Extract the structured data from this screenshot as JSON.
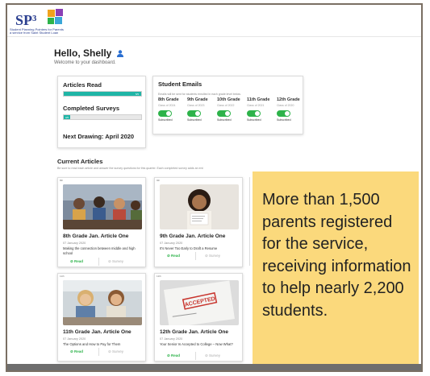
{
  "logo": {
    "text": "SP³",
    "tagline": "Student Planning Pointers for Parents\na service from Saint Student Loan"
  },
  "header": {
    "greeting": "Hello, Shelly",
    "welcome": "Welcome to your dashboard."
  },
  "stats": {
    "articles_read_label": "Articles Read",
    "articles_read_progress": 1.0,
    "articles_read_text": "5/5",
    "completed_surveys_label": "Completed Surveys",
    "completed_surveys_progress": 0.08,
    "completed_surveys_text": "0/5",
    "next_drawing": "Next Drawing: April 2020"
  },
  "emails": {
    "title": "Student Emails",
    "subtitle": "Emails will be sent for students enrolled in each grade level below.",
    "grades": [
      {
        "grade": "8th Grade",
        "class": "Class of 2024",
        "status": "Subscribed"
      },
      {
        "grade": "9th Grade",
        "class": "Class of 2023",
        "status": "Subscribed"
      },
      {
        "grade": "10th Grade",
        "class": "Class of 2022",
        "status": "Subscribed"
      },
      {
        "grade": "11th Grade",
        "class": "Class of 2021",
        "status": "Subscribed"
      },
      {
        "grade": "12th Grade",
        "class": "Class of 2020",
        "status": "Subscribed"
      }
    ]
  },
  "current": {
    "title": "Current Articles",
    "subtitle": "Be sure to read each article and answer the survey questions for this quarter. Each completed survey adds an ent"
  },
  "articles": [
    {
      "badge": "8th",
      "title": "8th Grade Jan. Article One",
      "date": "07 January 2020",
      "desc": "Making the connection between middle and high school",
      "read": "Read",
      "survey": "Survey"
    },
    {
      "badge": "9th",
      "title": "9th Grade Jan. Article One",
      "date": "07 January 2020",
      "desc": "It's Never Too Early to Draft a Resume",
      "read": "Read",
      "survey": "Survey"
    },
    {
      "badge": "11th",
      "title": "11th Grade Jan. Article One",
      "date": "07 January 2020",
      "desc": "The Options and How to Pay for Them",
      "read": "Read",
      "survey": "Survey"
    },
    {
      "badge": "12th",
      "title": "12th Grade Jan. Article One",
      "date": "07 January 2020",
      "desc": "Your Senior Is Accepted to College – Now What?",
      "read": "Read",
      "survey": "Survey"
    }
  ],
  "callout": {
    "text": "More than 1,500 parents registered for the service, receiving information to help nearly 2,200 students."
  },
  "colors": {
    "accent": "#1fb5a6",
    "toggle": "#2db34a",
    "callout": "#fbd97c",
    "brand": "#2a3e8f"
  }
}
